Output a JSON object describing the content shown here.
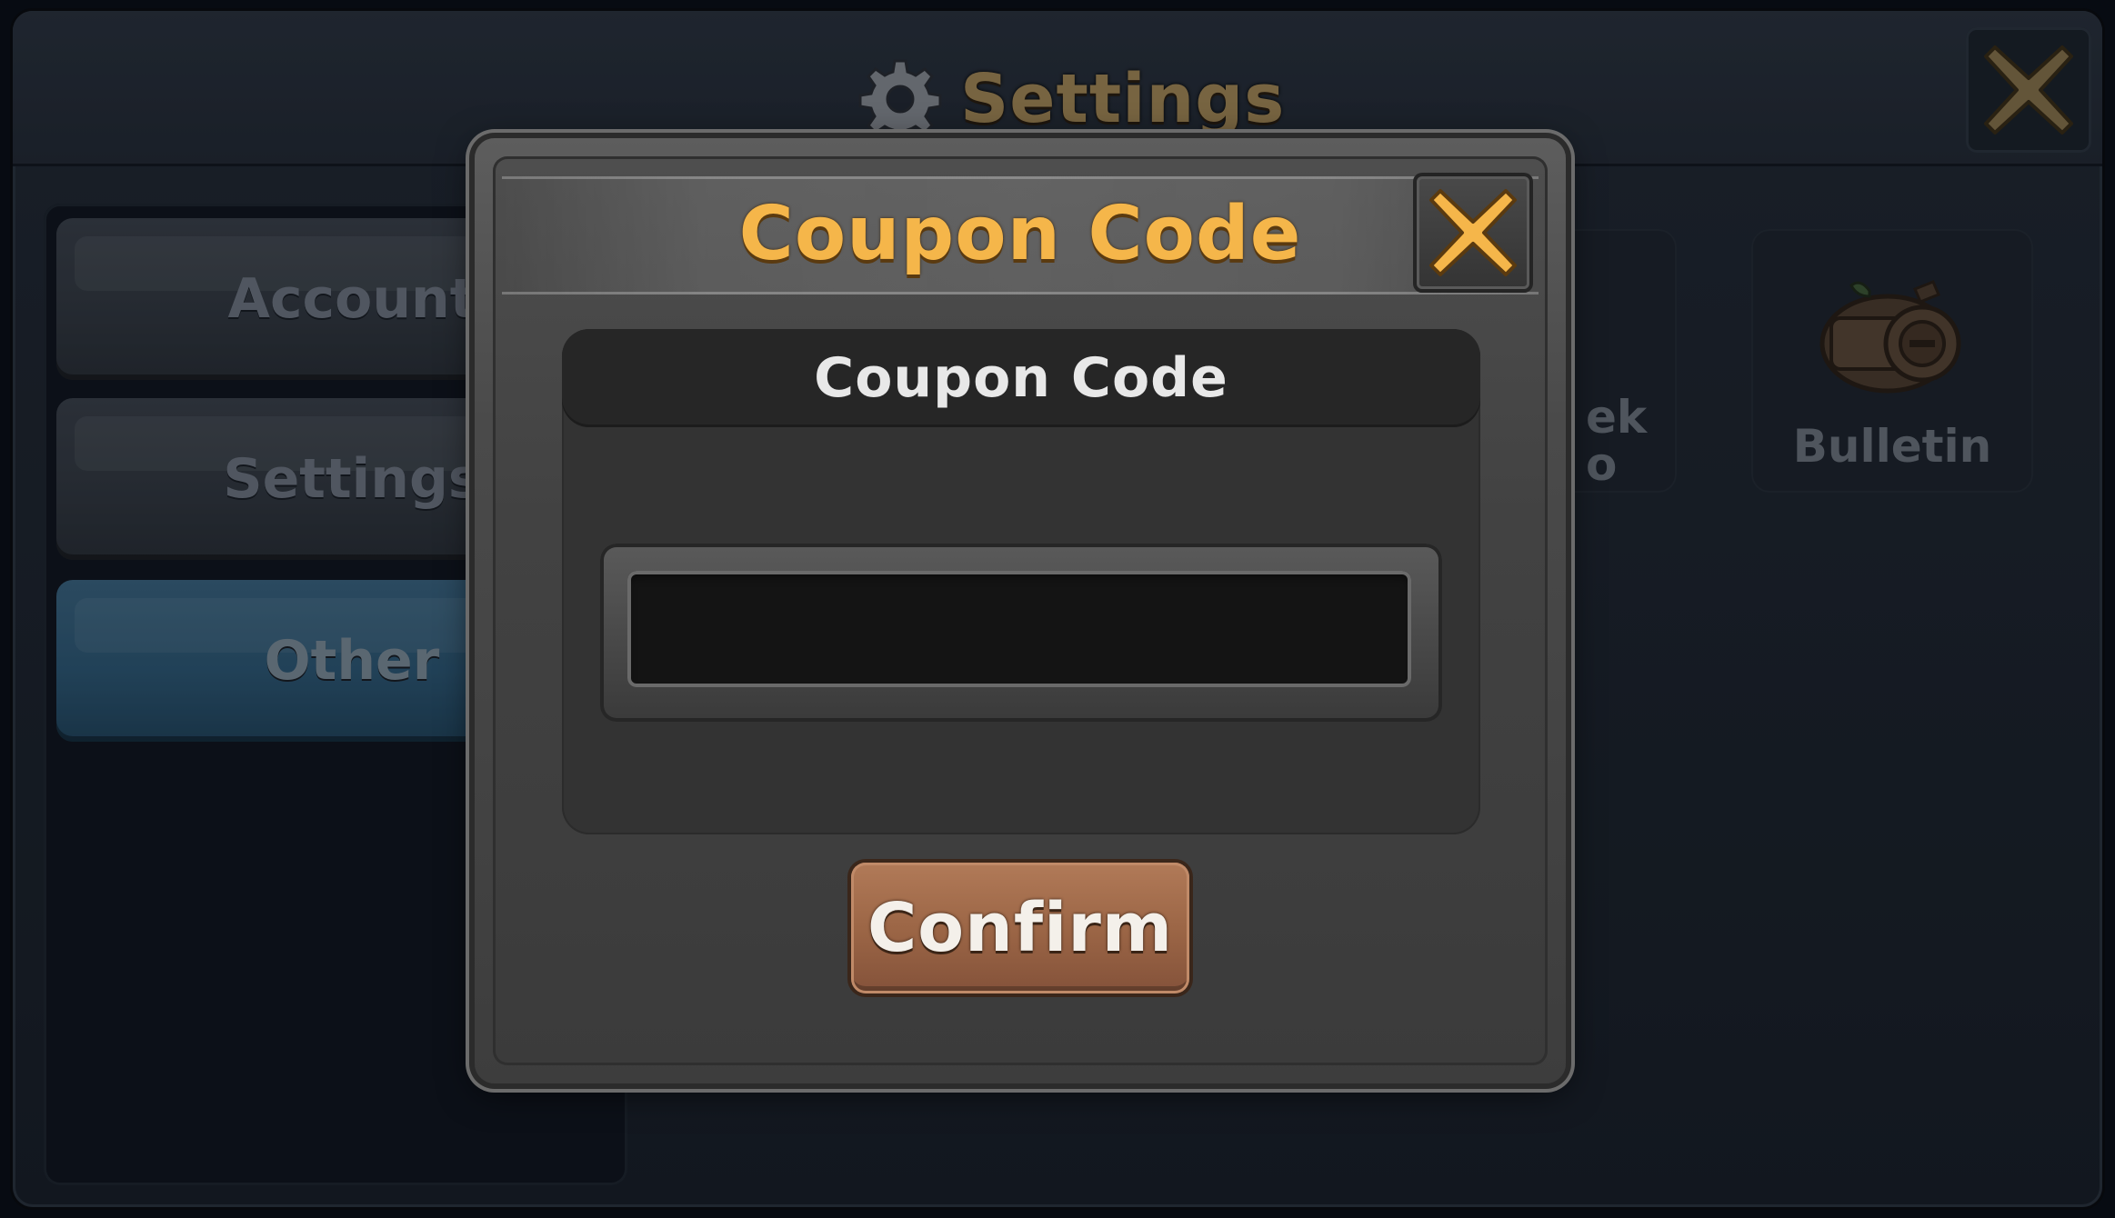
{
  "settings_window": {
    "title": "Settings",
    "title_icon": "gear-icon",
    "close_icon": "close-icon"
  },
  "sidebar": {
    "tabs": [
      {
        "label": "Account",
        "active": false
      },
      {
        "label": "Settings",
        "active": false
      },
      {
        "label": "Other",
        "active": true
      }
    ]
  },
  "tiles": {
    "partial_label_line1": "ek",
    "partial_label_line2": "o",
    "bulletin_label": "Bulletin",
    "bulletin_icon": "bulletin-board-icon"
  },
  "coupon_dialog": {
    "title": "Coupon Code",
    "field_label": "Coupon Code",
    "input_value": "",
    "input_placeholder": "",
    "confirm_label": "Confirm",
    "close_icon": "close-icon"
  },
  "colors": {
    "title_gold": "#f5b64a",
    "settings_title": "#a68b5b",
    "active_tab_blue": "#2f5b7a",
    "confirm_brown": "#9c6646"
  }
}
